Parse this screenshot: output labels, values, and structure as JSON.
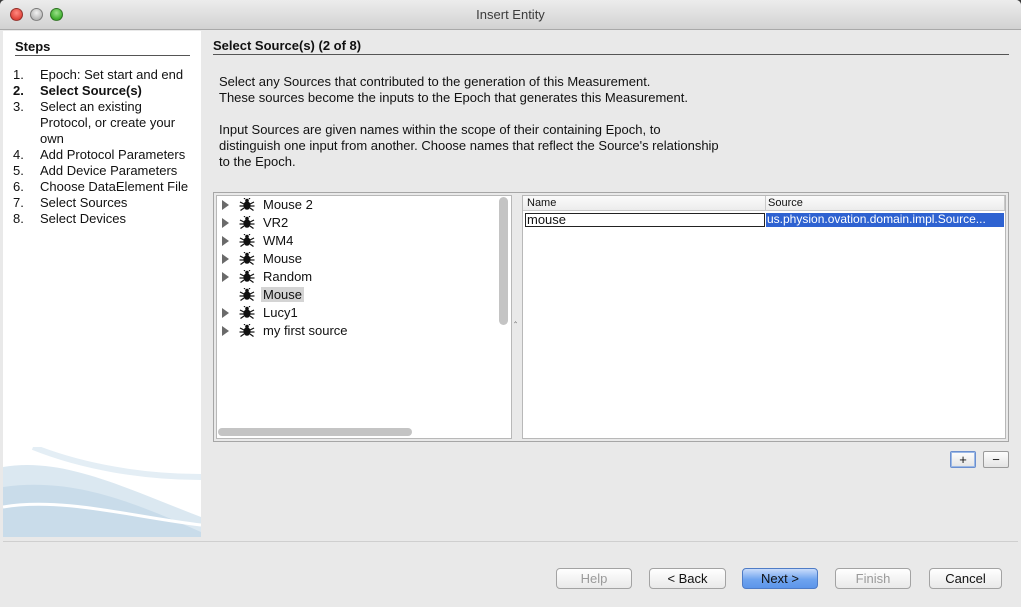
{
  "window": {
    "title": "Insert Entity"
  },
  "steps": {
    "heading": "Steps",
    "items": [
      {
        "num": "1.",
        "label": "Epoch: Set start and end",
        "active": false
      },
      {
        "num": "2.",
        "label": "Select Source(s)",
        "active": true
      },
      {
        "num": "3.",
        "label": "Select an existing Protocol, or create your own",
        "active": false
      },
      {
        "num": "4.",
        "label": "Add Protocol Parameters",
        "active": false
      },
      {
        "num": "5.",
        "label": "Add Device Parameters",
        "active": false
      },
      {
        "num": "6.",
        "label": "Choose DataElement File",
        "active": false
      },
      {
        "num": "7.",
        "label": "Select Sources",
        "active": false
      },
      {
        "num": "8.",
        "label": "Select Devices",
        "active": false
      }
    ]
  },
  "main": {
    "title": "Select Source(s) (2 of 8)",
    "desc1a": "Select any Sources that contributed to the generation of this Measurement.",
    "desc1b": "These sources become the inputs to the Epoch that generates this Measurement.",
    "desc2a": "Input Sources are given names within the scope of their containing Epoch, to",
    "desc2b": "distinguish one input from another. Choose names that reflect the Source's relationship",
    "desc2c": "to the Epoch."
  },
  "tree": {
    "items": [
      {
        "label": "Mouse 2",
        "expandable": true,
        "selected": false
      },
      {
        "label": "VR2",
        "expandable": true,
        "selected": false
      },
      {
        "label": "WM4",
        "expandable": true,
        "selected": false
      },
      {
        "label": "Mouse",
        "expandable": true,
        "selected": false
      },
      {
        "label": "Random",
        "expandable": true,
        "selected": false
      },
      {
        "label": "Mouse",
        "expandable": false,
        "selected": true
      },
      {
        "label": "Lucy1",
        "expandable": true,
        "selected": false
      },
      {
        "label": "my first source",
        "expandable": true,
        "selected": false
      }
    ],
    "icon": "bug-icon"
  },
  "table": {
    "columns": [
      "Name",
      "Source"
    ],
    "rows": [
      {
        "name": "mouse",
        "source": "us.physion.ovation.domain.impl.Source..."
      }
    ]
  },
  "controls": {
    "add_label": "+",
    "remove_label": "−"
  },
  "buttons": {
    "help": "Help",
    "back": "< Back",
    "next": "Next >",
    "finish": "Finish",
    "cancel": "Cancel"
  },
  "colors": {
    "selection": "#2e62d1",
    "primary_button": "#5c95ea"
  }
}
